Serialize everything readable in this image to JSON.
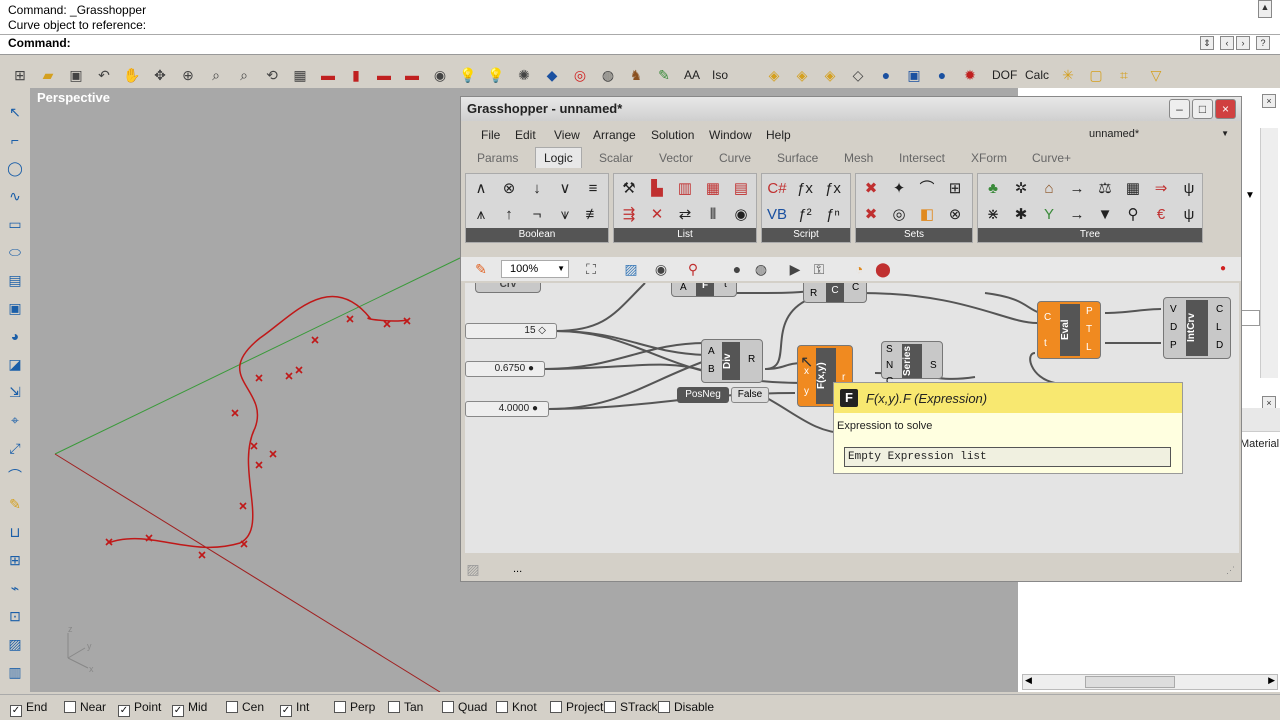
{
  "command": {
    "line1": "Command: _Grasshopper",
    "line2": "Curve object to reference:",
    "prompt": "Command:"
  },
  "toolbar": {
    "text_aa": "AA",
    "text_iso": "Iso",
    "text_dof": "DOF",
    "text_calc": "Calc"
  },
  "viewport": {
    "label": "Perspective"
  },
  "grasshopper": {
    "title": "Grasshopper - unnamed*",
    "menu": [
      "File",
      "Edit",
      "View",
      "Arrange",
      "Solution",
      "Window",
      "Help"
    ],
    "document": "unnamed*",
    "tabs": [
      "Params",
      "Logic",
      "Scalar",
      "Vector",
      "Curve",
      "Surface",
      "Mesh",
      "Intersect",
      "XForm",
      "Curve+"
    ],
    "active_tab": "Logic",
    "groups": [
      "Boolean",
      "List",
      "Script",
      "Sets",
      "Tree"
    ],
    "zoom": "100%",
    "status_dots": "...",
    "canvas": {
      "crv_label": "Crv",
      "slider_15": "15",
      "slider_0675": "0.6750",
      "slider_4": "4.0000",
      "div_label": "Div",
      "div_in_a": "A",
      "div_in_b": "B",
      "div_out_r": "R",
      "posneg": "PosNeg",
      "false_text": "False",
      "fxy_label": "F(x,y)",
      "fxy_in_x": "x",
      "fxy_in_y": "y",
      "fxy_out_r": "r",
      "series_label": "Series",
      "series_s": "S",
      "series_n": "N",
      "series_c": "C",
      "series_out": "S",
      "eval_label": "Eval",
      "eval_c": "C",
      "eval_t": "t",
      "eval_p": "P",
      "eval_t2": "T",
      "eval_l": "L",
      "intcrv_label": "IntCrv",
      "intcrv_v": "V",
      "intcrv_d": "D",
      "intcrv_p": "P",
      "intcrv_c": "C",
      "intcrv_l": "L",
      "intcrv_d2": "D",
      "top_comp_a": "A",
      "top_comp_f": "F",
      "top_comp_t": "t",
      "top_r": "R",
      "top_c_label": "C",
      "top_c": "C"
    }
  },
  "tooltip": {
    "icon": "F",
    "title": "F(x,y).F (Expression)",
    "description": "Expression to solve",
    "value": "Empty Expression list"
  },
  "right_panel": {
    "material": "Material"
  },
  "osnaps": [
    {
      "label": "End",
      "checked": true
    },
    {
      "label": "Near",
      "checked": false
    },
    {
      "label": "Point",
      "checked": true
    },
    {
      "label": "Mid",
      "checked": true
    },
    {
      "label": "Cen",
      "checked": false
    },
    {
      "label": "Int",
      "checked": true
    },
    {
      "label": "Perp",
      "checked": false
    },
    {
      "label": "Tan",
      "checked": false
    },
    {
      "label": "Quad",
      "checked": false
    },
    {
      "label": "Knot",
      "checked": false
    },
    {
      "label": "Project",
      "checked": false
    },
    {
      "label": "STrack",
      "checked": false
    },
    {
      "label": "Disable",
      "checked": false
    }
  ],
  "colors": {
    "curve_red": "#c01818",
    "axis_green": "#3a9a3a",
    "gh_orange": "#f08a20",
    "tooltip_yellow": "#f8e870"
  }
}
